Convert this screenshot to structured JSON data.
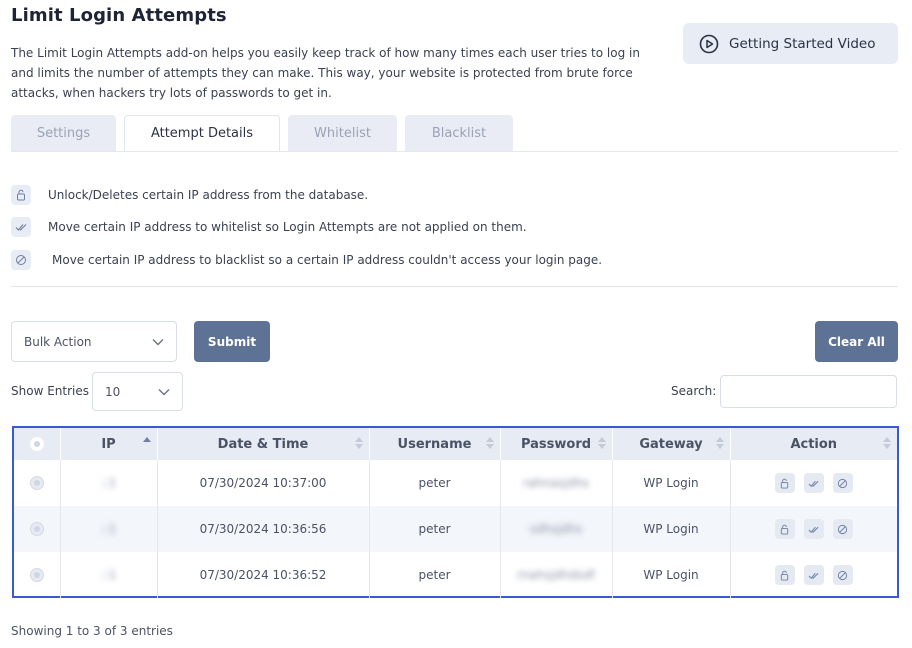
{
  "header": {
    "title": "Limit Login Attempts",
    "description": "The Limit Login Attempts add-on helps you easily keep track of how many times each user tries to log in and limits the number of attempts they can make. This way, your website is protected from brute force attacks, when hackers try lots of passwords to get in.",
    "video_button": "Getting Started Video"
  },
  "tabs": [
    {
      "label": "Settings",
      "active": false
    },
    {
      "label": "Attempt Details",
      "active": true
    },
    {
      "label": "Whitelist",
      "active": false
    },
    {
      "label": "Blacklist",
      "active": false
    }
  ],
  "legend": [
    {
      "icon": "unlock-icon",
      "text": "Unlock/Deletes certain IP address from the database."
    },
    {
      "icon": "double-check-icon",
      "text": "Move certain IP address to whitelist so Login Attempts are not applied on them."
    },
    {
      "icon": "block-icon",
      "text": "Move certain IP address to blacklist so a certain IP address couldn't access your login page."
    }
  ],
  "controls": {
    "bulk_action": "Bulk Action",
    "submit": "Submit",
    "clear_all": "Clear All",
    "show_entries_label": "Show Entries",
    "show_entries_value": "10",
    "search_label": "Search:",
    "search_value": ""
  },
  "table": {
    "columns": [
      "IP",
      "Date & Time",
      "Username",
      "Password",
      "Gateway",
      "Action"
    ],
    "rows": [
      {
        "ip": "::1",
        "datetime": "07/30/2024 10:37:00",
        "username": "peter",
        "password": "rahnasjdhs",
        "gateway": "WP Login"
      },
      {
        "ip": "::1",
        "datetime": "07/30/2024 10:36:56",
        "username": "peter",
        "password": "sdhsjdhs",
        "gateway": "WP Login"
      },
      {
        "ip": "::1",
        "datetime": "07/30/2024 10:36:52",
        "username": "peter",
        "password": "rnahsjdhdsdf",
        "gateway": "WP Login"
      }
    ]
  },
  "footer": {
    "info": "Showing 1 to 3 of 3 entries"
  },
  "colors": {
    "accent_button": "#5d7295",
    "highlight_border": "#3c59d4",
    "table_header": "#e6ebf4"
  }
}
